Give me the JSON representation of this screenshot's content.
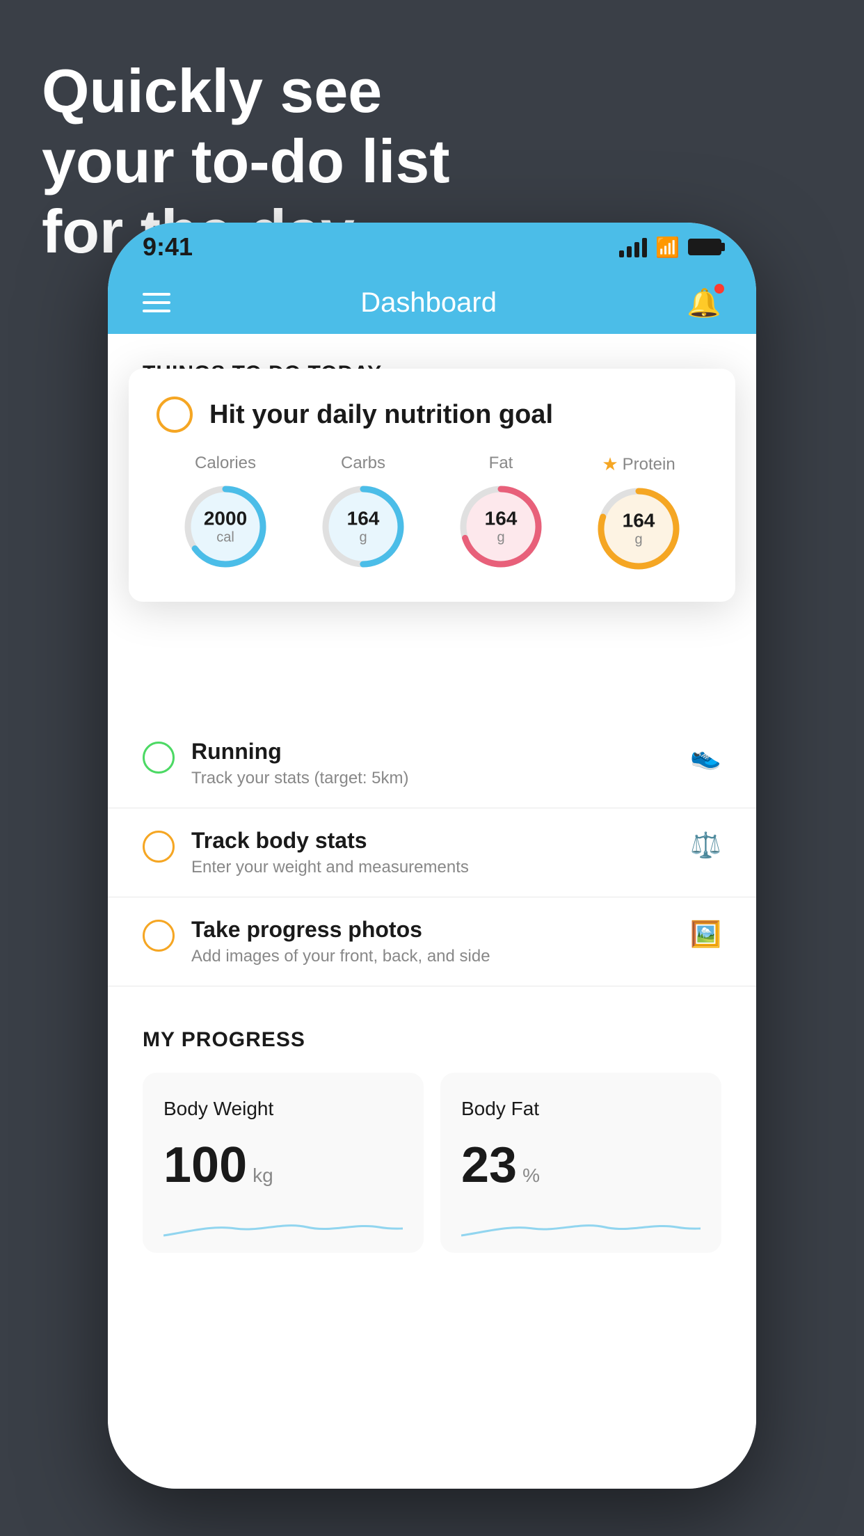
{
  "headline": {
    "line1": "Quickly see",
    "line2": "your to-do list",
    "line3": "for the day."
  },
  "status_bar": {
    "time": "9:41"
  },
  "nav": {
    "title": "Dashboard"
  },
  "section_header": "THINGS TO DO TODAY",
  "floating_card": {
    "title": "Hit your daily nutrition goal",
    "nutrition": [
      {
        "label": "Calories",
        "value": "2000",
        "unit": "cal",
        "color": "#4bbde8",
        "starred": false,
        "bg_color": "#e8f6fd",
        "percent": 65
      },
      {
        "label": "Carbs",
        "value": "164",
        "unit": "g",
        "color": "#4bbde8",
        "starred": false,
        "bg_color": "#e8f6fd",
        "percent": 50
      },
      {
        "label": "Fat",
        "value": "164",
        "unit": "g",
        "color": "#e8607a",
        "starred": false,
        "bg_color": "#fde8ec",
        "percent": 70
      },
      {
        "label": "Protein",
        "value": "164",
        "unit": "g",
        "color": "#f5a623",
        "starred": true,
        "bg_color": "#fdf3e3",
        "percent": 80
      }
    ]
  },
  "todo_items": [
    {
      "title": "Running",
      "subtitle": "Track your stats (target: 5km)",
      "circle_color": "green",
      "icon": "👟"
    },
    {
      "title": "Track body stats",
      "subtitle": "Enter your weight and measurements",
      "circle_color": "yellow",
      "icon": "⚖️"
    },
    {
      "title": "Take progress photos",
      "subtitle": "Add images of your front, back, and side",
      "circle_color": "yellow",
      "icon": "🖼️"
    }
  ],
  "progress_section": {
    "title": "MY PROGRESS",
    "cards": [
      {
        "title": "Body Weight",
        "value": "100",
        "unit": "kg"
      },
      {
        "title": "Body Fat",
        "value": "23",
        "unit": "%"
      }
    ]
  }
}
